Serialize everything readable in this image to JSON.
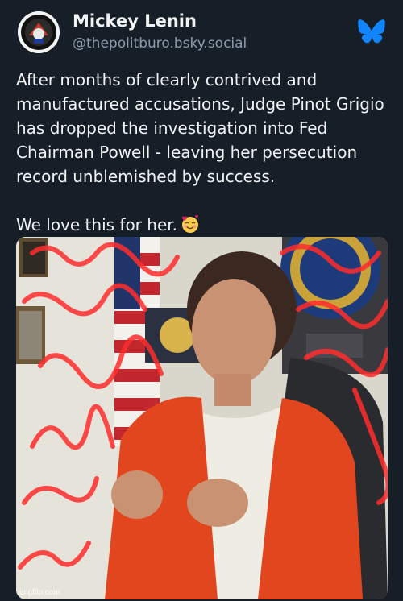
{
  "author": {
    "display_name": "Mickey Lenin",
    "handle": "@thepolitburo.bsky.social",
    "avatar_icon": "avatar-logo-icon"
  },
  "platform_icon": "bluesky-butterfly-icon",
  "post": {
    "paragraphs": [
      "After months of clearly contrived and manufactured accusations, Judge Pinot Grigio has dropped the investigation into Fed Chairman Powell - leaving her persecution record unblemished by success.",
      "We love this for her."
    ],
    "emoji": "smiling-face-with-hearts-icon"
  },
  "media": {
    "watermark": "imgflip.com"
  },
  "colors": {
    "background": "#161e27",
    "text": "#f1f3f5",
    "muted": "#8d9cad",
    "accent": "#1185fe"
  }
}
